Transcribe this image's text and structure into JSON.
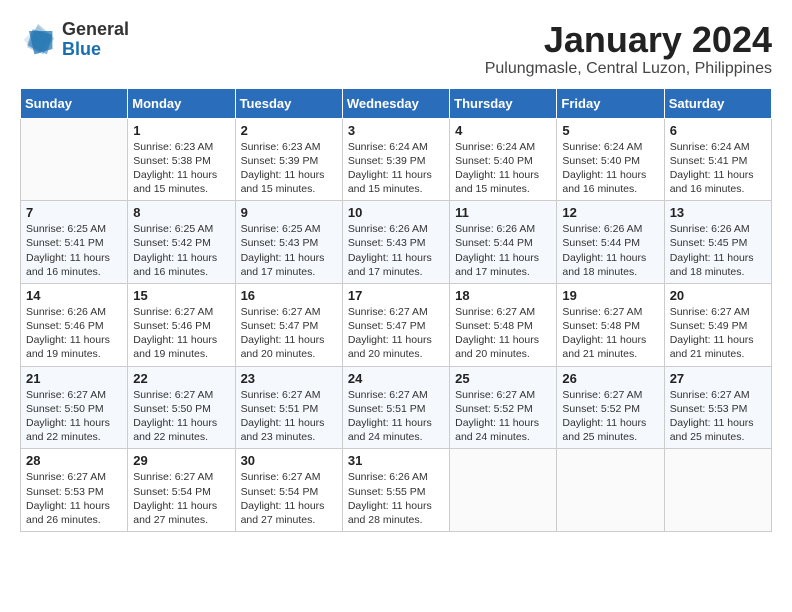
{
  "header": {
    "logo_general": "General",
    "logo_blue": "Blue",
    "month_title": "January 2024",
    "location": "Pulungmasle, Central Luzon, Philippines"
  },
  "days_of_week": [
    "Sunday",
    "Monday",
    "Tuesday",
    "Wednesday",
    "Thursday",
    "Friday",
    "Saturday"
  ],
  "weeks": [
    [
      {
        "day": "",
        "info": ""
      },
      {
        "day": "1",
        "info": "Sunrise: 6:23 AM\nSunset: 5:38 PM\nDaylight: 11 hours\nand 15 minutes."
      },
      {
        "day": "2",
        "info": "Sunrise: 6:23 AM\nSunset: 5:39 PM\nDaylight: 11 hours\nand 15 minutes."
      },
      {
        "day": "3",
        "info": "Sunrise: 6:24 AM\nSunset: 5:39 PM\nDaylight: 11 hours\nand 15 minutes."
      },
      {
        "day": "4",
        "info": "Sunrise: 6:24 AM\nSunset: 5:40 PM\nDaylight: 11 hours\nand 15 minutes."
      },
      {
        "day": "5",
        "info": "Sunrise: 6:24 AM\nSunset: 5:40 PM\nDaylight: 11 hours\nand 16 minutes."
      },
      {
        "day": "6",
        "info": "Sunrise: 6:24 AM\nSunset: 5:41 PM\nDaylight: 11 hours\nand 16 minutes."
      }
    ],
    [
      {
        "day": "7",
        "info": "Sunrise: 6:25 AM\nSunset: 5:41 PM\nDaylight: 11 hours\nand 16 minutes."
      },
      {
        "day": "8",
        "info": "Sunrise: 6:25 AM\nSunset: 5:42 PM\nDaylight: 11 hours\nand 16 minutes."
      },
      {
        "day": "9",
        "info": "Sunrise: 6:25 AM\nSunset: 5:43 PM\nDaylight: 11 hours\nand 17 minutes."
      },
      {
        "day": "10",
        "info": "Sunrise: 6:26 AM\nSunset: 5:43 PM\nDaylight: 11 hours\nand 17 minutes."
      },
      {
        "day": "11",
        "info": "Sunrise: 6:26 AM\nSunset: 5:44 PM\nDaylight: 11 hours\nand 17 minutes."
      },
      {
        "day": "12",
        "info": "Sunrise: 6:26 AM\nSunset: 5:44 PM\nDaylight: 11 hours\nand 18 minutes."
      },
      {
        "day": "13",
        "info": "Sunrise: 6:26 AM\nSunset: 5:45 PM\nDaylight: 11 hours\nand 18 minutes."
      }
    ],
    [
      {
        "day": "14",
        "info": "Sunrise: 6:26 AM\nSunset: 5:46 PM\nDaylight: 11 hours\nand 19 minutes."
      },
      {
        "day": "15",
        "info": "Sunrise: 6:27 AM\nSunset: 5:46 PM\nDaylight: 11 hours\nand 19 minutes."
      },
      {
        "day": "16",
        "info": "Sunrise: 6:27 AM\nSunset: 5:47 PM\nDaylight: 11 hours\nand 20 minutes."
      },
      {
        "day": "17",
        "info": "Sunrise: 6:27 AM\nSunset: 5:47 PM\nDaylight: 11 hours\nand 20 minutes."
      },
      {
        "day": "18",
        "info": "Sunrise: 6:27 AM\nSunset: 5:48 PM\nDaylight: 11 hours\nand 20 minutes."
      },
      {
        "day": "19",
        "info": "Sunrise: 6:27 AM\nSunset: 5:48 PM\nDaylight: 11 hours\nand 21 minutes."
      },
      {
        "day": "20",
        "info": "Sunrise: 6:27 AM\nSunset: 5:49 PM\nDaylight: 11 hours\nand 21 minutes."
      }
    ],
    [
      {
        "day": "21",
        "info": "Sunrise: 6:27 AM\nSunset: 5:50 PM\nDaylight: 11 hours\nand 22 minutes."
      },
      {
        "day": "22",
        "info": "Sunrise: 6:27 AM\nSunset: 5:50 PM\nDaylight: 11 hours\nand 22 minutes."
      },
      {
        "day": "23",
        "info": "Sunrise: 6:27 AM\nSunset: 5:51 PM\nDaylight: 11 hours\nand 23 minutes."
      },
      {
        "day": "24",
        "info": "Sunrise: 6:27 AM\nSunset: 5:51 PM\nDaylight: 11 hours\nand 24 minutes."
      },
      {
        "day": "25",
        "info": "Sunrise: 6:27 AM\nSunset: 5:52 PM\nDaylight: 11 hours\nand 24 minutes."
      },
      {
        "day": "26",
        "info": "Sunrise: 6:27 AM\nSunset: 5:52 PM\nDaylight: 11 hours\nand 25 minutes."
      },
      {
        "day": "27",
        "info": "Sunrise: 6:27 AM\nSunset: 5:53 PM\nDaylight: 11 hours\nand 25 minutes."
      }
    ],
    [
      {
        "day": "28",
        "info": "Sunrise: 6:27 AM\nSunset: 5:53 PM\nDaylight: 11 hours\nand 26 minutes."
      },
      {
        "day": "29",
        "info": "Sunrise: 6:27 AM\nSunset: 5:54 PM\nDaylight: 11 hours\nand 27 minutes."
      },
      {
        "day": "30",
        "info": "Sunrise: 6:27 AM\nSunset: 5:54 PM\nDaylight: 11 hours\nand 27 minutes."
      },
      {
        "day": "31",
        "info": "Sunrise: 6:26 AM\nSunset: 5:55 PM\nDaylight: 11 hours\nand 28 minutes."
      },
      {
        "day": "",
        "info": ""
      },
      {
        "day": "",
        "info": ""
      },
      {
        "day": "",
        "info": ""
      }
    ]
  ]
}
